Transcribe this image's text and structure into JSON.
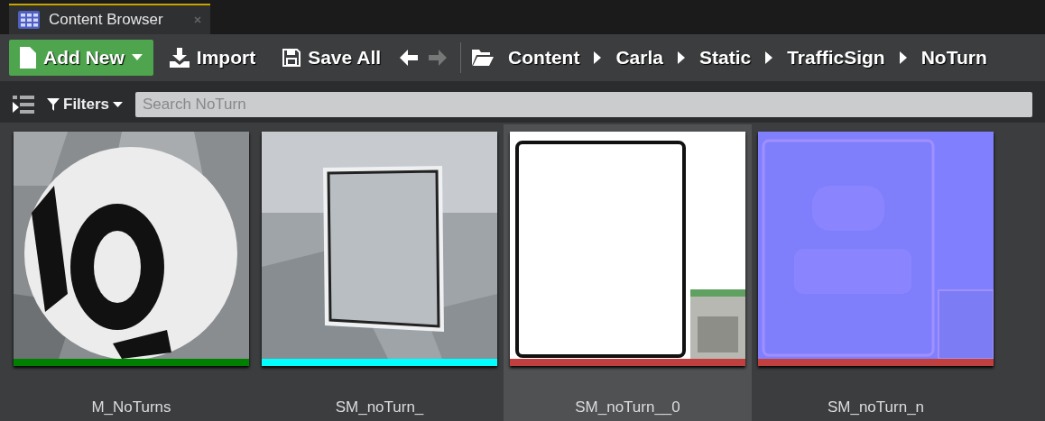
{
  "tab": {
    "title": "Content Browser"
  },
  "toolbar": {
    "add_new": "Add New",
    "import": "Import",
    "save_all": "Save All",
    "back_disabled": false,
    "forward_disabled": true
  },
  "breadcrumbs": [
    "Content",
    "Carla",
    "Static",
    "TrafficSign",
    "NoTurn"
  ],
  "filters": {
    "label": "Filters",
    "search": {
      "placeholder": "Search NoTurn"
    }
  },
  "assets": [
    {
      "name": "M_NoTurns",
      "color": "#008000",
      "selected": false,
      "kind": "sphere"
    },
    {
      "name": "SM_noTurn_",
      "color": "#00ffff",
      "selected": false,
      "kind": "sign"
    },
    {
      "name": "SM_noTurn__0",
      "color": "#c04040",
      "selected": true,
      "kind": "texture"
    },
    {
      "name": "SM_noTurn_n",
      "color": "#c04040",
      "selected": false,
      "kind": "normal"
    }
  ]
}
